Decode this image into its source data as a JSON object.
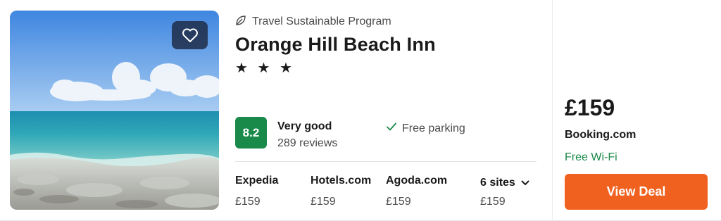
{
  "hotel": {
    "program_label": "Travel Sustainable Program",
    "name": "Orange Hill Beach Inn",
    "stars": "★ ★ ★",
    "star_count": 3,
    "score": "8.2",
    "rating_label": "Very good",
    "reviews": "289 reviews",
    "amenity": "Free parking"
  },
  "sites": [
    {
      "name": "Expedia",
      "price": "£159"
    },
    {
      "name": "Hotels.com",
      "price": "£159"
    },
    {
      "name": "Agoda.com",
      "price": "£159"
    }
  ],
  "more_sites": {
    "label": "6 sites",
    "price": "£159"
  },
  "deal": {
    "price": "£159",
    "provider": "Booking.com",
    "perk": "Free Wi-Fi",
    "button_label": "View Deal"
  },
  "colors": {
    "score_badge": "#1a8a4a",
    "deal_button": "#f0611f",
    "perk_text": "#1a8a4a",
    "favorite_button": "#1c2842"
  },
  "icons": {
    "favorite": "heart-icon",
    "program": "leaf-icon",
    "amenity": "check-icon",
    "more_sites": "chevron-down-icon"
  }
}
